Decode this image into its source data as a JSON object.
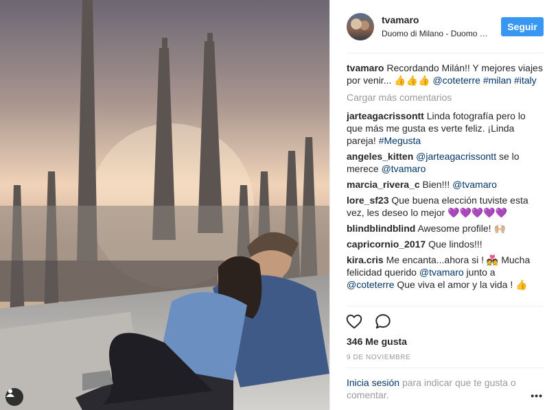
{
  "header": {
    "username": "tvamaro",
    "location": "Duomo di Milano - Duomo di Milano",
    "follow_label": "Seguir"
  },
  "caption": {
    "user": "tvamaro",
    "text": "Recordando Milán!! Y mejores viajes por venir... 👍👍👍",
    "mention": "@coteterre",
    "tags": "#milan #italy"
  },
  "load_more_label": "Cargar más comentarios",
  "comments": [
    {
      "user": "jarteagacrissontt",
      "text": "Linda fotografía pero lo que más me gusta es verte feliz. ¡Linda pareja!",
      "tag": "#Megusta"
    },
    {
      "user": "angeles_kitten",
      "mention": "@jarteagacrissontt",
      "text": "se lo merece",
      "mention2": "@tvamaro"
    },
    {
      "user": "marcia_rivera_c",
      "text": "Bien!!!",
      "mention": "@tvamaro"
    },
    {
      "user": "lore_sf23",
      "text": "Que buena elección tuviste esta vez, les deseo lo mejor 💜💜💜💜💜"
    },
    {
      "user": "blindblindblind",
      "text": "Awesome profile! 🙌🏼"
    },
    {
      "user": "capricornio_2017",
      "text": "Que lindos!!!"
    },
    {
      "user": "kira.cris",
      "text": "Me encanta...ahora si ! 💑 Mucha felicidad querido",
      "mention": "@tvamaro",
      "text2": "junto a",
      "mention2": "@coteterre",
      "text3": "Que viva el amor y la vida ! 👍"
    }
  ],
  "icons": [
    "heart-icon",
    "comment-icon",
    "user-tag-icon",
    "more-icon"
  ],
  "likes_label": "346 Me gusta",
  "date_label": "9 de noviembre",
  "login": {
    "link": "Inicia sesión",
    "text": "para indicar que te gusta o comentar.",
    "more": "•••"
  },
  "colors": {
    "follow_button": "#3897f0",
    "link": "#003569",
    "muted": "#999999"
  }
}
